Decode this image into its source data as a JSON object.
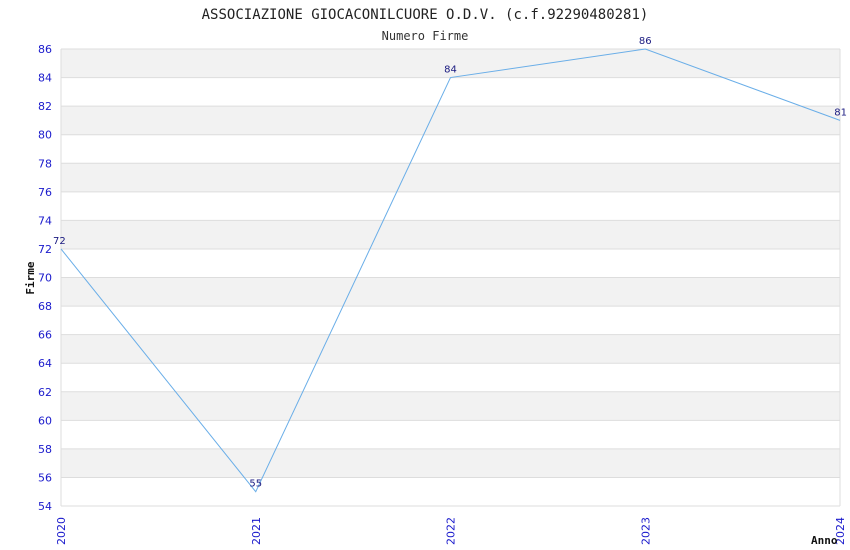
{
  "chart_data": {
    "type": "line",
    "title": "ASSOCIAZIONE GIOCACONILCUORE O.D.V. (c.f.92290480281)",
    "subtitle": "Numero Firme",
    "xlabel": "Anno",
    "ylabel": "Firme",
    "categories": [
      "2020",
      "2021",
      "2022",
      "2023",
      "2024"
    ],
    "series": [
      {
        "values": [
          72,
          55,
          84,
          86,
          81
        ]
      }
    ],
    "ylim": [
      54,
      86
    ],
    "yticks": [
      "54",
      "56",
      "58",
      "60",
      "62",
      "64",
      "66",
      "68",
      "70",
      "72",
      "74",
      "76",
      "78",
      "80",
      "82",
      "84",
      "86"
    ],
    "grid": true,
    "colors": {
      "line": "#6aaee8",
      "band": "#f2f2f2",
      "gridline": "#dddddd",
      "tick_text": "#1a1acc",
      "data_label": "#1a1a80"
    }
  }
}
